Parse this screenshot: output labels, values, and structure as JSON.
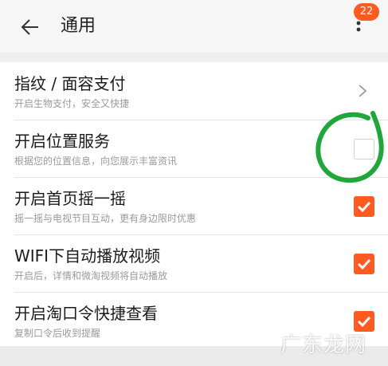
{
  "header": {
    "title": "通用",
    "badge_count": "22",
    "back_icon": "arrow-left-icon",
    "more_icon": "more-vertical-icon"
  },
  "settings": {
    "items": [
      {
        "title": "指纹 / 面容支付",
        "subtitle": "开启生物支付，安全又快捷",
        "control": "chevron"
      },
      {
        "title": "开启位置服务",
        "subtitle": "根据您的位置信息，向您展示丰富资讯",
        "control": "checkbox",
        "checked": false
      },
      {
        "title": "开启首页摇一摇",
        "subtitle": "摇一摇与电视节目互动，更有身边限时优惠",
        "control": "checkbox",
        "checked": true
      },
      {
        "title": "WIFI下自动播放视频",
        "subtitle": "开启后，详情和微淘视频将自动播放",
        "control": "checkbox",
        "checked": true
      },
      {
        "title": "开启淘口令快捷查看",
        "subtitle": "复制口令后收到提醒",
        "control": "checkbox",
        "checked": true
      }
    ]
  },
  "watermark": {
    "text": "广东龙网"
  },
  "colors": {
    "accent": "#ff5a1f",
    "annotation": "#1ea83a",
    "background": "#efefef",
    "text_primary": "#1a1a1a",
    "text_secondary": "#9a9a9a"
  }
}
